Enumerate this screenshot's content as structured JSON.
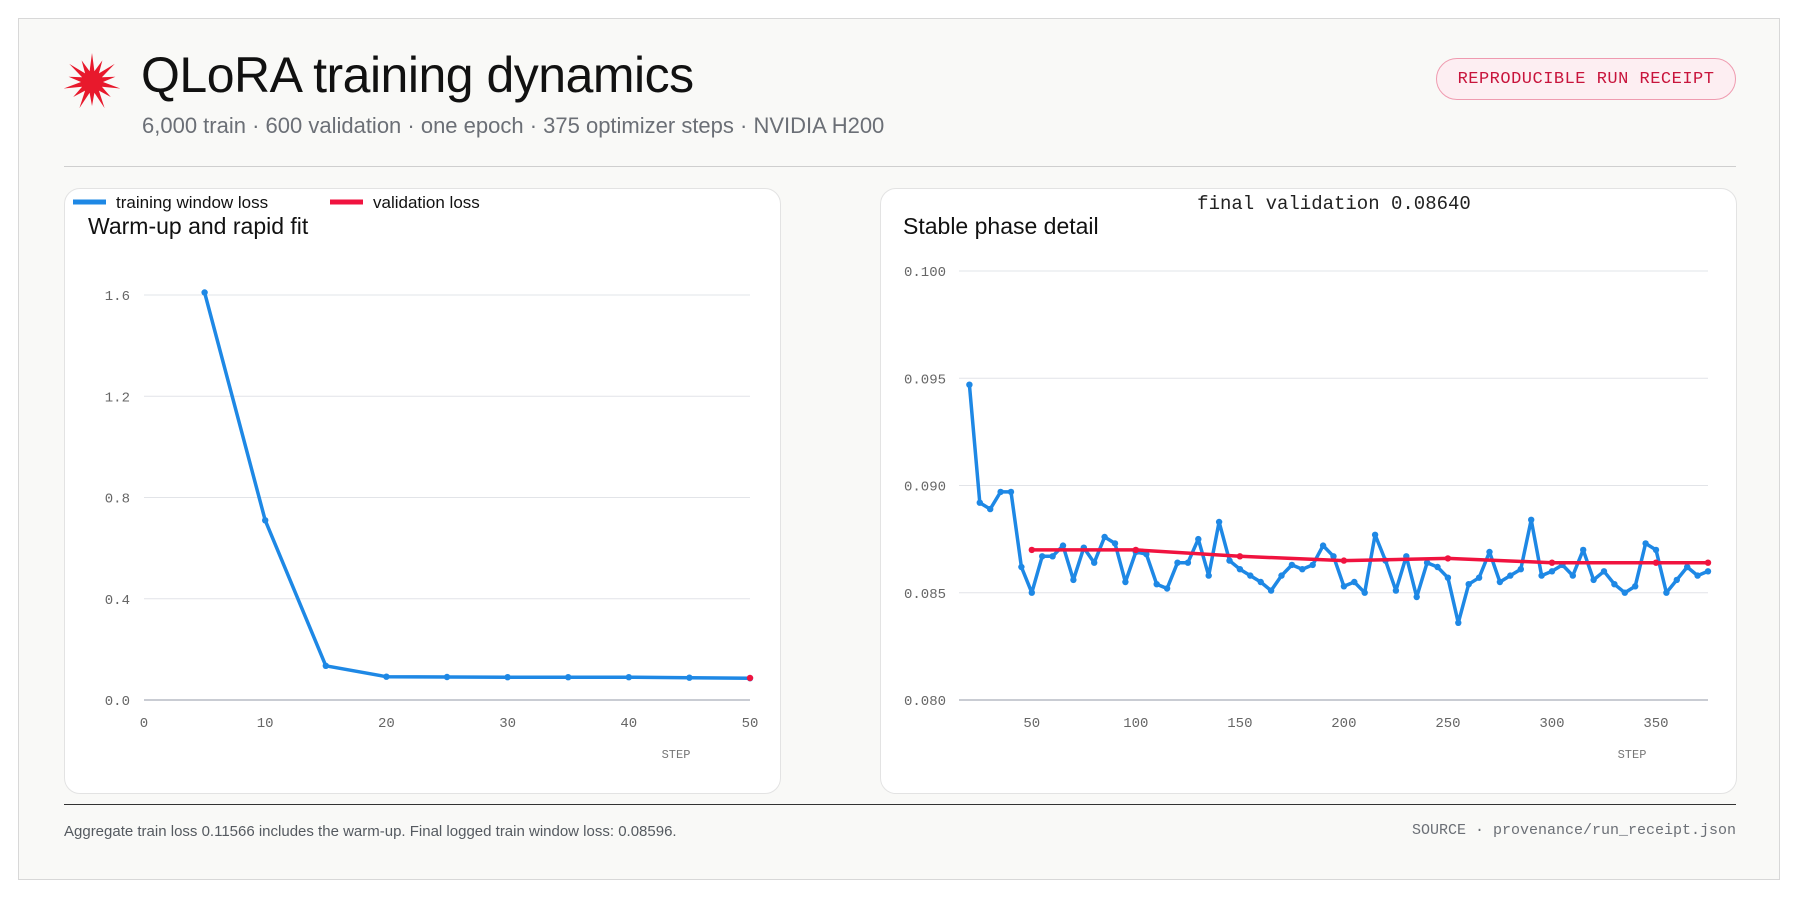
{
  "header": {
    "title": "QLoRA training dynamics",
    "subtitle": "6,000 train · 600 validation · one epoch · 375 optimizer steps · NVIDIA H200",
    "badge": "REPRODUCIBLE RUN RECEIPT",
    "logo_icon": "red-starburst-icon"
  },
  "legend": {
    "train_label": "training window loss",
    "val_label": "validation loss"
  },
  "colors": {
    "train": "#1e88e5",
    "validation": "#f0133f",
    "accent": "#e8192c"
  },
  "annotation": "final validation 0.08640",
  "chart_data": [
    {
      "type": "line",
      "title": "Warm-up and rapid fit",
      "xlabel": "STEP",
      "ylabel": "",
      "xlim": [
        0,
        50
      ],
      "ylim": [
        0,
        1.6
      ],
      "xticks": [
        "0",
        "10",
        "20",
        "30",
        "40",
        "50"
      ],
      "yticks": [
        "0.0",
        "0.4",
        "0.8",
        "1.2",
        "1.6"
      ],
      "grid": true,
      "series": [
        {
          "name": "training window loss",
          "x": [
            5,
            10,
            15,
            20,
            25,
            30,
            35,
            40,
            45,
            50
          ],
          "y": [
            1.61,
            0.71,
            0.135,
            0.092,
            0.091,
            0.09,
            0.09,
            0.09,
            0.088,
            0.086
          ]
        },
        {
          "name": "validation loss",
          "x": [
            50
          ],
          "y": [
            0.087
          ]
        }
      ]
    },
    {
      "type": "line",
      "title": "Stable phase detail",
      "xlabel": "STEP",
      "ylabel": "",
      "xlim": [
        15,
        375
      ],
      "ylim": [
        0.08,
        0.1
      ],
      "xticks": [
        "50",
        "100",
        "150",
        "200",
        "250",
        "300",
        "350"
      ],
      "yticks": [
        "0.080",
        "0.085",
        "0.090",
        "0.095",
        "0.100"
      ],
      "grid": true,
      "series": [
        {
          "name": "training window loss",
          "x": [
            20,
            25,
            30,
            35,
            40,
            45,
            50,
            55,
            60,
            65,
            70,
            75,
            80,
            85,
            90,
            95,
            100,
            105,
            110,
            115,
            120,
            125,
            130,
            135,
            140,
            145,
            150,
            155,
            160,
            165,
            170,
            175,
            180,
            185,
            190,
            195,
            200,
            205,
            210,
            215,
            220,
            225,
            230,
            235,
            240,
            245,
            250,
            255,
            260,
            265,
            270,
            275,
            280,
            285,
            290,
            295,
            300,
            305,
            310,
            315,
            320,
            325,
            330,
            335,
            340,
            345,
            350,
            355,
            360,
            365,
            370,
            375
          ],
          "y": [
            0.0947,
            0.0892,
            0.0889,
            0.0897,
            0.0897,
            0.0862,
            0.085,
            0.0867,
            0.0867,
            0.0872,
            0.0856,
            0.0871,
            0.0864,
            0.0876,
            0.0873,
            0.0855,
            0.0869,
            0.0868,
            0.0854,
            0.0852,
            0.0864,
            0.0864,
            0.0875,
            0.0858,
            0.0883,
            0.0865,
            0.0861,
            0.0858,
            0.0855,
            0.0851,
            0.0858,
            0.0863,
            0.0861,
            0.0863,
            0.0872,
            0.0867,
            0.0853,
            0.0855,
            0.085,
            0.0877,
            0.0865,
            0.0851,
            0.0867,
            0.0848,
            0.0864,
            0.0862,
            0.0857,
            0.0836,
            0.0854,
            0.0857,
            0.0869,
            0.0855,
            0.0858,
            0.0861,
            0.0884,
            0.0858,
            0.086,
            0.0863,
            0.0858,
            0.087,
            0.0856,
            0.086,
            0.0854,
            0.085,
            0.0853,
            0.0873,
            0.087,
            0.085,
            0.0856,
            0.0862,
            0.0858,
            0.086
          ]
        },
        {
          "name": "validation loss",
          "x": [
            50,
            100,
            150,
            200,
            250,
            300,
            350,
            375
          ],
          "y": [
            0.087,
            0.087,
            0.0867,
            0.0865,
            0.0866,
            0.0864,
            0.0864,
            0.0864
          ]
        }
      ]
    }
  ],
  "footer": {
    "note": "Aggregate train loss 0.11566 includes the warm-up. Final logged train window loss: 0.08596.",
    "source": "SOURCE · provenance/run_receipt.json"
  }
}
